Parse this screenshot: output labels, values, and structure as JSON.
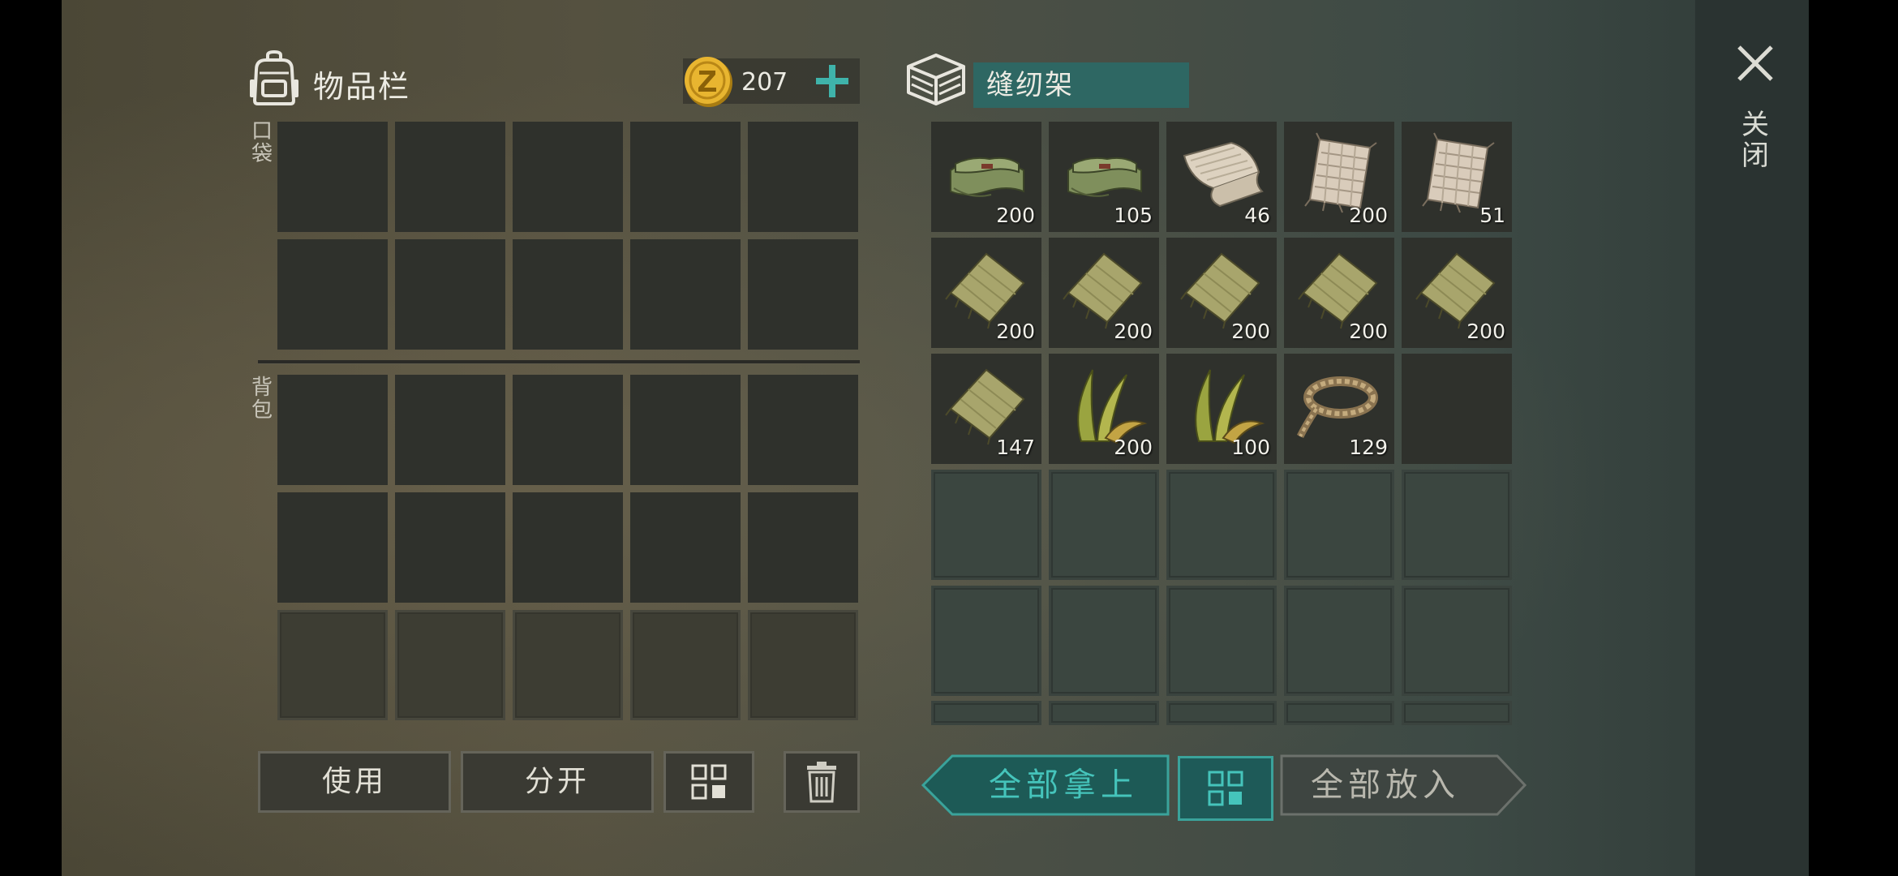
{
  "inventory": {
    "title": "物品栏",
    "pocket_label": "口袋",
    "backpack_label": "背包"
  },
  "currency": {
    "amount": "207"
  },
  "station": {
    "title": "缝纫架",
    "items": [
      {
        "item": "green-cloth",
        "count": "200"
      },
      {
        "item": "green-cloth",
        "count": "105"
      },
      {
        "item": "fabric-roll",
        "count": "46"
      },
      {
        "item": "linen-scrap",
        "count": "200"
      },
      {
        "item": "linen-scrap",
        "count": "51"
      },
      {
        "item": "rag",
        "count": "200"
      },
      {
        "item": "rag",
        "count": "200"
      },
      {
        "item": "rag",
        "count": "200"
      },
      {
        "item": "rag",
        "count": "200"
      },
      {
        "item": "rag",
        "count": "200"
      },
      {
        "item": "rag",
        "count": "147"
      },
      {
        "item": "plant-fiber",
        "count": "200"
      },
      {
        "item": "plant-fiber",
        "count": "100"
      },
      {
        "item": "rope",
        "count": "129"
      }
    ]
  },
  "close": {
    "label": "关闭"
  },
  "buttons": {
    "use": "使用",
    "split": "分开",
    "take_all": "全部拿上",
    "put_all": "全部放入"
  },
  "colors": {
    "accent": "#45c4bb",
    "station_title_bg": "#2e6763"
  }
}
